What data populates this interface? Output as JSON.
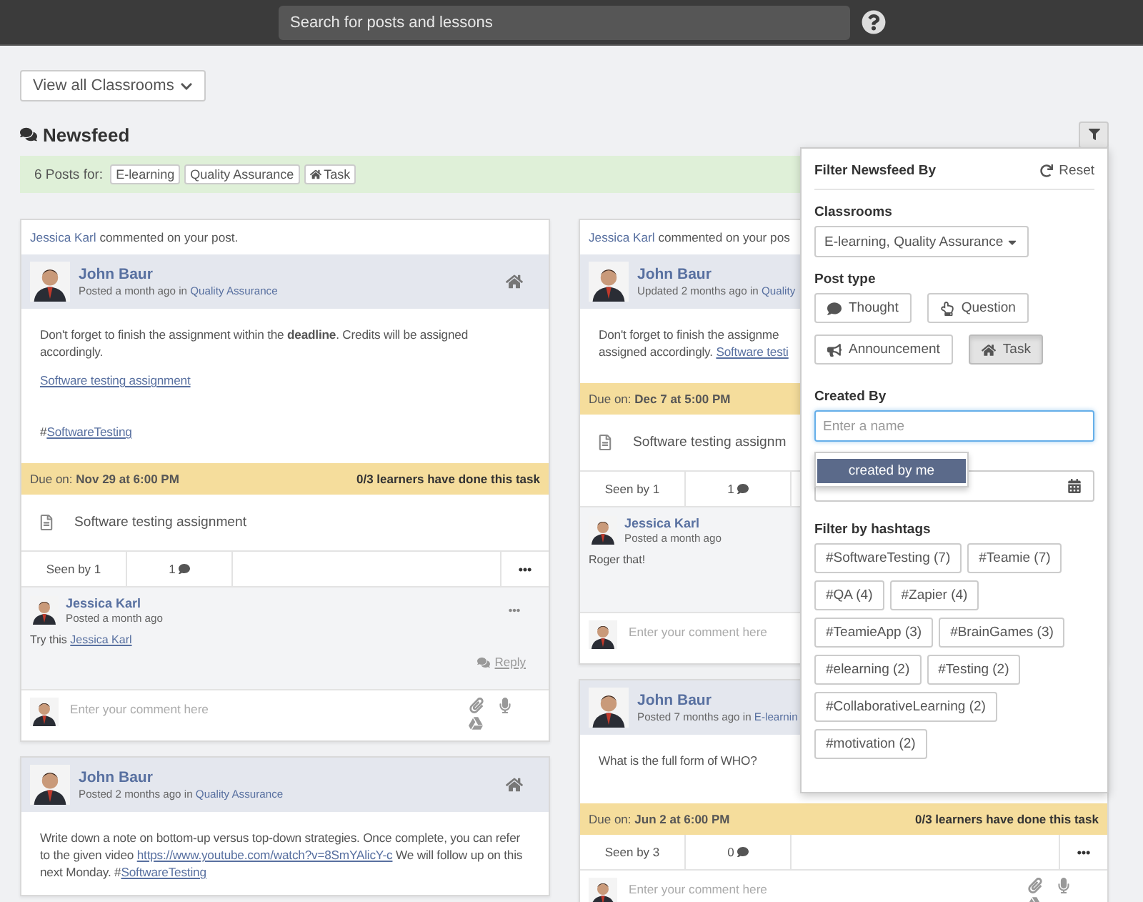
{
  "topbar": {
    "search": {
      "placeholder": "Search for posts and lessons"
    }
  },
  "classroom_button": "View all Classrooms",
  "heading": "Newsfeed",
  "filter_summary": {
    "label": "6 Posts for:",
    "tags": [
      {
        "label": "E-learning",
        "kind": "text"
      },
      {
        "label": "Quality Assurance",
        "kind": "text"
      },
      {
        "label": "Task",
        "kind": "task"
      }
    ]
  },
  "columns": [
    [
      {
        "notice": {
          "actor": "Jessica Karl",
          "text": "commented on your post."
        },
        "author": "John Baur",
        "meta": "Posted a month ago in",
        "classroom": "Quality Assurance",
        "home_icon": true,
        "body": [
          [
            {
              "kind": "text",
              "text": "Don't forget to finish the assignment within the **deadline**. Credits will be assigned accordingly."
            }
          ],
          [
            {
              "kind": "link",
              "text": "Software testing assignment"
            }
          ],
          [
            {
              "kind": "text",
              "text": "#"
            },
            {
              "kind": "link",
              "text": "SoftwareTesting"
            }
          ]
        ],
        "due": {
          "label": "Due on:",
          "date": "Nov 29 at 6:00 PM",
          "progress": "0/3 learners have done this task"
        },
        "attachment": "Software testing assignment",
        "stats": {
          "seen": "Seen by 1",
          "comments": "1",
          "menu": true
        },
        "comments": [
          {
            "author": "Jessica Karl",
            "time": "Posted a month ago",
            "menu": true,
            "segments": [
              {
                "kind": "text",
                "text": "Try this "
              },
              {
                "kind": "link",
                "text": "Jessica Karl"
              }
            ],
            "reply": "Reply"
          }
        ],
        "comment_box": {
          "placeholder": "Enter your comment here",
          "icons": true
        }
      },
      {
        "author": "John Baur",
        "meta": "Posted 2 months ago in",
        "classroom": "Quality Assurance",
        "home_icon": true,
        "body": [
          [
            {
              "kind": "text",
              "text": "Write down a note on bottom-up versus top-down strategies. Once complete, you can refer to the given video "
            },
            {
              "kind": "link",
              "text": "https://www.youtube.com/watch?v=8SmYAlicY-c"
            },
            {
              "kind": "text",
              "text": " We will follow up on this next Monday. #"
            },
            {
              "kind": "link",
              "text": "SoftwareTesting"
            }
          ]
        ]
      }
    ],
    [
      {
        "notice": {
          "actor": "Jessica Karl",
          "text": "commented on your pos"
        },
        "author": "John Baur",
        "meta": "Updated 2 months ago in",
        "classroom": "Quality",
        "home_icon": false,
        "body": [
          [
            {
              "kind": "text",
              "text": "Don't forget to finish the assignme"
            },
            {
              "kind": "break"
            },
            {
              "kind": "text",
              "text": "assigned accordingly. "
            },
            {
              "kind": "link",
              "text": "Software testi"
            }
          ]
        ],
        "due": {
          "label": "Due on:",
          "date": "Dec 7 at 5:00 PM"
        },
        "attachment": "Software testing assignm",
        "stats": {
          "seen": "Seen by 1",
          "comments": "1",
          "menu": false
        },
        "comments": [
          {
            "author": "Jessica Karl",
            "time": "Posted a month ago",
            "menu": false,
            "segments": [
              {
                "kind": "text",
                "text": "Roger that!"
              }
            ]
          }
        ],
        "comment_box": {
          "placeholder": "Enter your comment here",
          "icons": false
        }
      },
      {
        "author": "John Baur",
        "meta": "Posted 7 months ago in",
        "classroom": "E-learnin",
        "home_icon": false,
        "body": [
          [
            {
              "kind": "text",
              "text": "What is the full form of WHO?"
            }
          ]
        ],
        "due": {
          "label": "Due on:",
          "date": "Jun 2 at 6:00 PM",
          "progress": "0/3 learners have done this task"
        },
        "stats": {
          "seen": "Seen by 3",
          "comments": "0",
          "menu": true
        },
        "comment_box": {
          "placeholder": "Enter your comment here",
          "icons": true
        }
      }
    ]
  ],
  "filter_panel": {
    "title": "Filter Newsfeed By",
    "reset": "Reset",
    "classrooms": {
      "label": "Classrooms",
      "value": "E-learning, Quality Assurance"
    },
    "post_type": {
      "label": "Post type",
      "options": [
        {
          "label": "Thought",
          "kind": "thought",
          "selected": false
        },
        {
          "label": "Question",
          "kind": "question",
          "selected": false
        },
        {
          "label": "Announcement",
          "kind": "announcement",
          "selected": false
        },
        {
          "label": "Task",
          "kind": "task",
          "selected": true
        }
      ]
    },
    "created_by": {
      "label": "Created By",
      "placeholder": "Enter a name",
      "suggestion": "created by me"
    },
    "hashtags": {
      "label": "Filter by hashtags",
      "tags": [
        "#SoftwareTesting (7)",
        "#Teamie (7)",
        "#QA (4)",
        "#Zapier (4)",
        "#TeamieApp (3)",
        "#BrainGames (3)",
        "#elearning (2)",
        "#Testing (2)",
        "#CollaborativeLearning (2)",
        "#motivation (2)"
      ]
    }
  }
}
